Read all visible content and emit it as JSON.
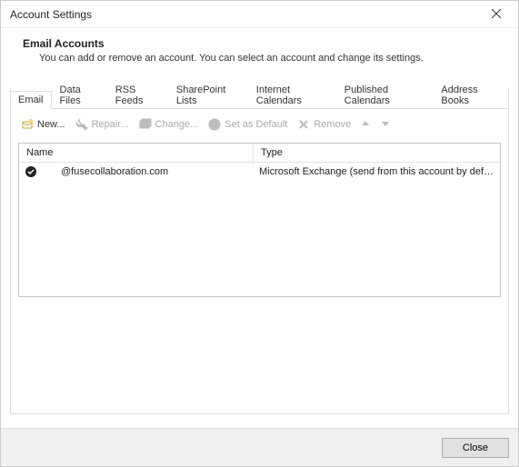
{
  "window": {
    "title": "Account Settings"
  },
  "header": {
    "heading": "Email Accounts",
    "description": "You can add or remove an account. You can select an account and change its settings."
  },
  "tabs": {
    "email": "Email",
    "data_files": "Data Files",
    "rss_feeds": "RSS Feeds",
    "sharepoint": "SharePoint Lists",
    "internet_cal": "Internet Calendars",
    "published_cal": "Published Calendars",
    "address_books": "Address Books"
  },
  "toolbar": {
    "new": "New...",
    "repair": "Repair...",
    "change": "Change...",
    "set_default": "Set as Default",
    "remove": "Remove"
  },
  "columns": {
    "name": "Name",
    "type": "Type"
  },
  "accounts": [
    {
      "name": "@fusecollaboration.com",
      "type": "Microsoft Exchange (send from this account by defa...",
      "default": true
    }
  ],
  "footer": {
    "close": "Close"
  }
}
